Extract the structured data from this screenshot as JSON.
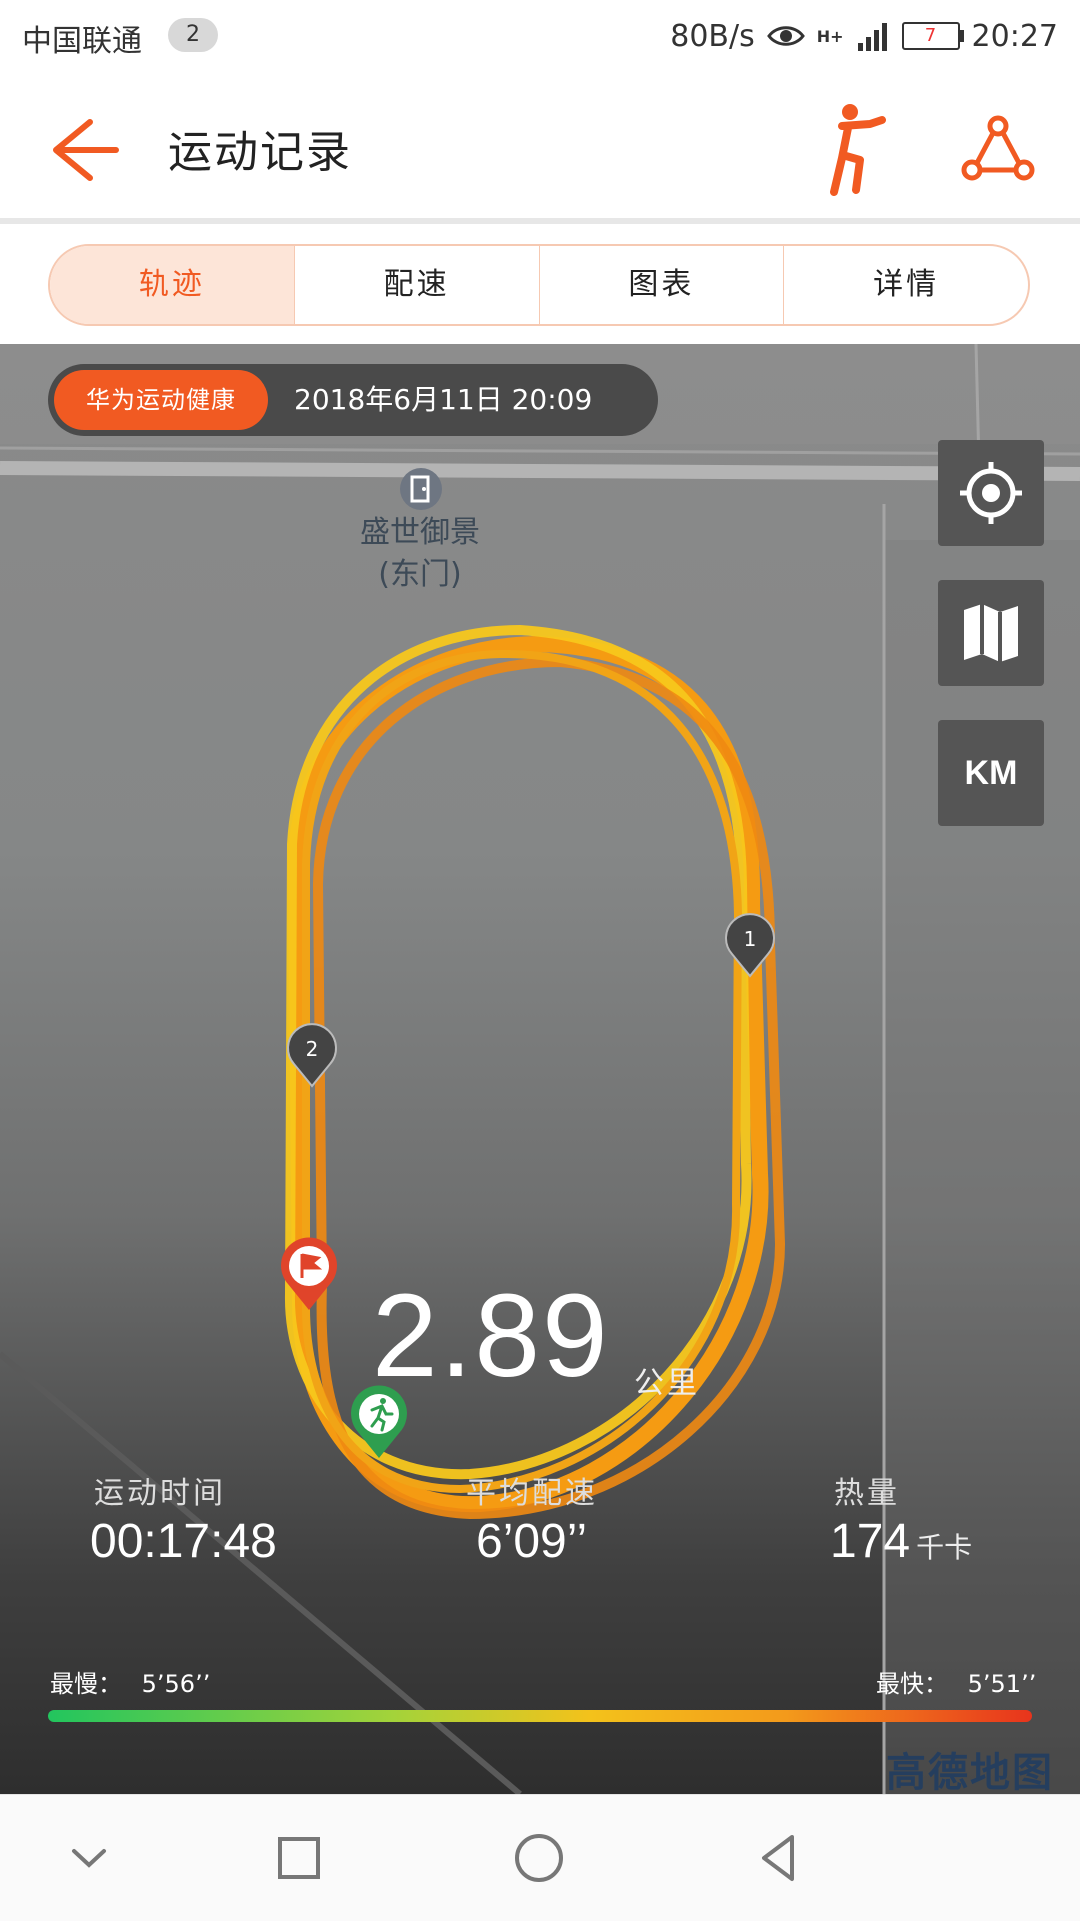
{
  "status_bar": {
    "carrier": "中国联通",
    "sim_badge": "2",
    "net_speed": "80B/s",
    "network": "H+",
    "battery": "7",
    "time": "20:27"
  },
  "app_bar": {
    "title": "运动记录",
    "accent_color": "#f15a22"
  },
  "tabs": [
    {
      "label": "轨迹",
      "active": true
    },
    {
      "label": "配速",
      "active": false
    },
    {
      "label": "图表",
      "active": false
    },
    {
      "label": "详情",
      "active": false
    }
  ],
  "map": {
    "source_pill": "华为运动健康",
    "date": "2018年6月11日 20:09",
    "poi": {
      "name_line1": "盛世御景",
      "name_line2": "(东门)"
    },
    "controls": {
      "km_label": "KM"
    },
    "markers": {
      "lap1": "1",
      "lap2": "2"
    },
    "distance": {
      "value": "2.89",
      "unit": "公里"
    },
    "stats": {
      "time_label": "运动时间",
      "time_value": "00:17:48",
      "pace_label": "平均配速",
      "pace_value": "6’09’’",
      "calories_label": "热量",
      "calories_value": "174",
      "calories_unit": "千卡"
    },
    "pace_range": {
      "slowest_label": "最慢：",
      "slowest_value": "5’56’’",
      "fastest_label": "最快：",
      "fastest_value": "5’51’’"
    },
    "map_logo": "高德地图"
  }
}
